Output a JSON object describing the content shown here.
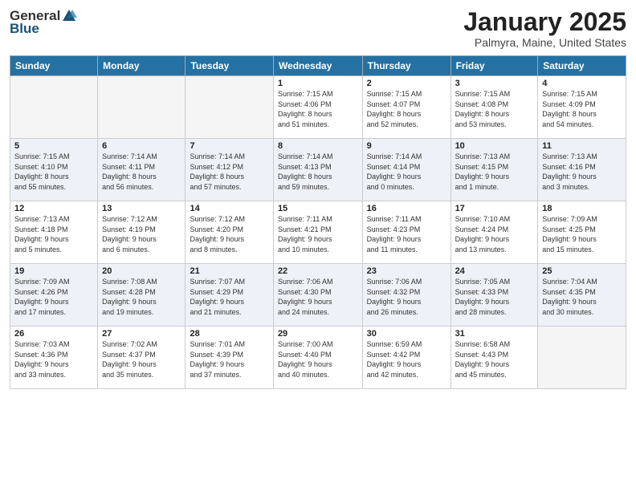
{
  "header": {
    "logo_general": "General",
    "logo_blue": "Blue",
    "month": "January 2025",
    "location": "Palmyra, Maine, United States"
  },
  "days_of_week": [
    "Sunday",
    "Monday",
    "Tuesday",
    "Wednesday",
    "Thursday",
    "Friday",
    "Saturday"
  ],
  "weeks": [
    [
      {
        "day": "",
        "detail": ""
      },
      {
        "day": "",
        "detail": ""
      },
      {
        "day": "",
        "detail": ""
      },
      {
        "day": "1",
        "detail": "Sunrise: 7:15 AM\nSunset: 4:06 PM\nDaylight: 8 hours\nand 51 minutes."
      },
      {
        "day": "2",
        "detail": "Sunrise: 7:15 AM\nSunset: 4:07 PM\nDaylight: 8 hours\nand 52 minutes."
      },
      {
        "day": "3",
        "detail": "Sunrise: 7:15 AM\nSunset: 4:08 PM\nDaylight: 8 hours\nand 53 minutes."
      },
      {
        "day": "4",
        "detail": "Sunrise: 7:15 AM\nSunset: 4:09 PM\nDaylight: 8 hours\nand 54 minutes."
      }
    ],
    [
      {
        "day": "5",
        "detail": "Sunrise: 7:15 AM\nSunset: 4:10 PM\nDaylight: 8 hours\nand 55 minutes."
      },
      {
        "day": "6",
        "detail": "Sunrise: 7:14 AM\nSunset: 4:11 PM\nDaylight: 8 hours\nand 56 minutes."
      },
      {
        "day": "7",
        "detail": "Sunrise: 7:14 AM\nSunset: 4:12 PM\nDaylight: 8 hours\nand 57 minutes."
      },
      {
        "day": "8",
        "detail": "Sunrise: 7:14 AM\nSunset: 4:13 PM\nDaylight: 8 hours\nand 59 minutes."
      },
      {
        "day": "9",
        "detail": "Sunrise: 7:14 AM\nSunset: 4:14 PM\nDaylight: 9 hours\nand 0 minutes."
      },
      {
        "day": "10",
        "detail": "Sunrise: 7:13 AM\nSunset: 4:15 PM\nDaylight: 9 hours\nand 1 minute."
      },
      {
        "day": "11",
        "detail": "Sunrise: 7:13 AM\nSunset: 4:16 PM\nDaylight: 9 hours\nand 3 minutes."
      }
    ],
    [
      {
        "day": "12",
        "detail": "Sunrise: 7:13 AM\nSunset: 4:18 PM\nDaylight: 9 hours\nand 5 minutes."
      },
      {
        "day": "13",
        "detail": "Sunrise: 7:12 AM\nSunset: 4:19 PM\nDaylight: 9 hours\nand 6 minutes."
      },
      {
        "day": "14",
        "detail": "Sunrise: 7:12 AM\nSunset: 4:20 PM\nDaylight: 9 hours\nand 8 minutes."
      },
      {
        "day": "15",
        "detail": "Sunrise: 7:11 AM\nSunset: 4:21 PM\nDaylight: 9 hours\nand 10 minutes."
      },
      {
        "day": "16",
        "detail": "Sunrise: 7:11 AM\nSunset: 4:23 PM\nDaylight: 9 hours\nand 11 minutes."
      },
      {
        "day": "17",
        "detail": "Sunrise: 7:10 AM\nSunset: 4:24 PM\nDaylight: 9 hours\nand 13 minutes."
      },
      {
        "day": "18",
        "detail": "Sunrise: 7:09 AM\nSunset: 4:25 PM\nDaylight: 9 hours\nand 15 minutes."
      }
    ],
    [
      {
        "day": "19",
        "detail": "Sunrise: 7:09 AM\nSunset: 4:26 PM\nDaylight: 9 hours\nand 17 minutes."
      },
      {
        "day": "20",
        "detail": "Sunrise: 7:08 AM\nSunset: 4:28 PM\nDaylight: 9 hours\nand 19 minutes."
      },
      {
        "day": "21",
        "detail": "Sunrise: 7:07 AM\nSunset: 4:29 PM\nDaylight: 9 hours\nand 21 minutes."
      },
      {
        "day": "22",
        "detail": "Sunrise: 7:06 AM\nSunset: 4:30 PM\nDaylight: 9 hours\nand 24 minutes."
      },
      {
        "day": "23",
        "detail": "Sunrise: 7:06 AM\nSunset: 4:32 PM\nDaylight: 9 hours\nand 26 minutes."
      },
      {
        "day": "24",
        "detail": "Sunrise: 7:05 AM\nSunset: 4:33 PM\nDaylight: 9 hours\nand 28 minutes."
      },
      {
        "day": "25",
        "detail": "Sunrise: 7:04 AM\nSunset: 4:35 PM\nDaylight: 9 hours\nand 30 minutes."
      }
    ],
    [
      {
        "day": "26",
        "detail": "Sunrise: 7:03 AM\nSunset: 4:36 PM\nDaylight: 9 hours\nand 33 minutes."
      },
      {
        "day": "27",
        "detail": "Sunrise: 7:02 AM\nSunset: 4:37 PM\nDaylight: 9 hours\nand 35 minutes."
      },
      {
        "day": "28",
        "detail": "Sunrise: 7:01 AM\nSunset: 4:39 PM\nDaylight: 9 hours\nand 37 minutes."
      },
      {
        "day": "29",
        "detail": "Sunrise: 7:00 AM\nSunset: 4:40 PM\nDaylight: 9 hours\nand 40 minutes."
      },
      {
        "day": "30",
        "detail": "Sunrise: 6:59 AM\nSunset: 4:42 PM\nDaylight: 9 hours\nand 42 minutes."
      },
      {
        "day": "31",
        "detail": "Sunrise: 6:58 AM\nSunset: 4:43 PM\nDaylight: 9 hours\nand 45 minutes."
      },
      {
        "day": "",
        "detail": ""
      }
    ]
  ]
}
